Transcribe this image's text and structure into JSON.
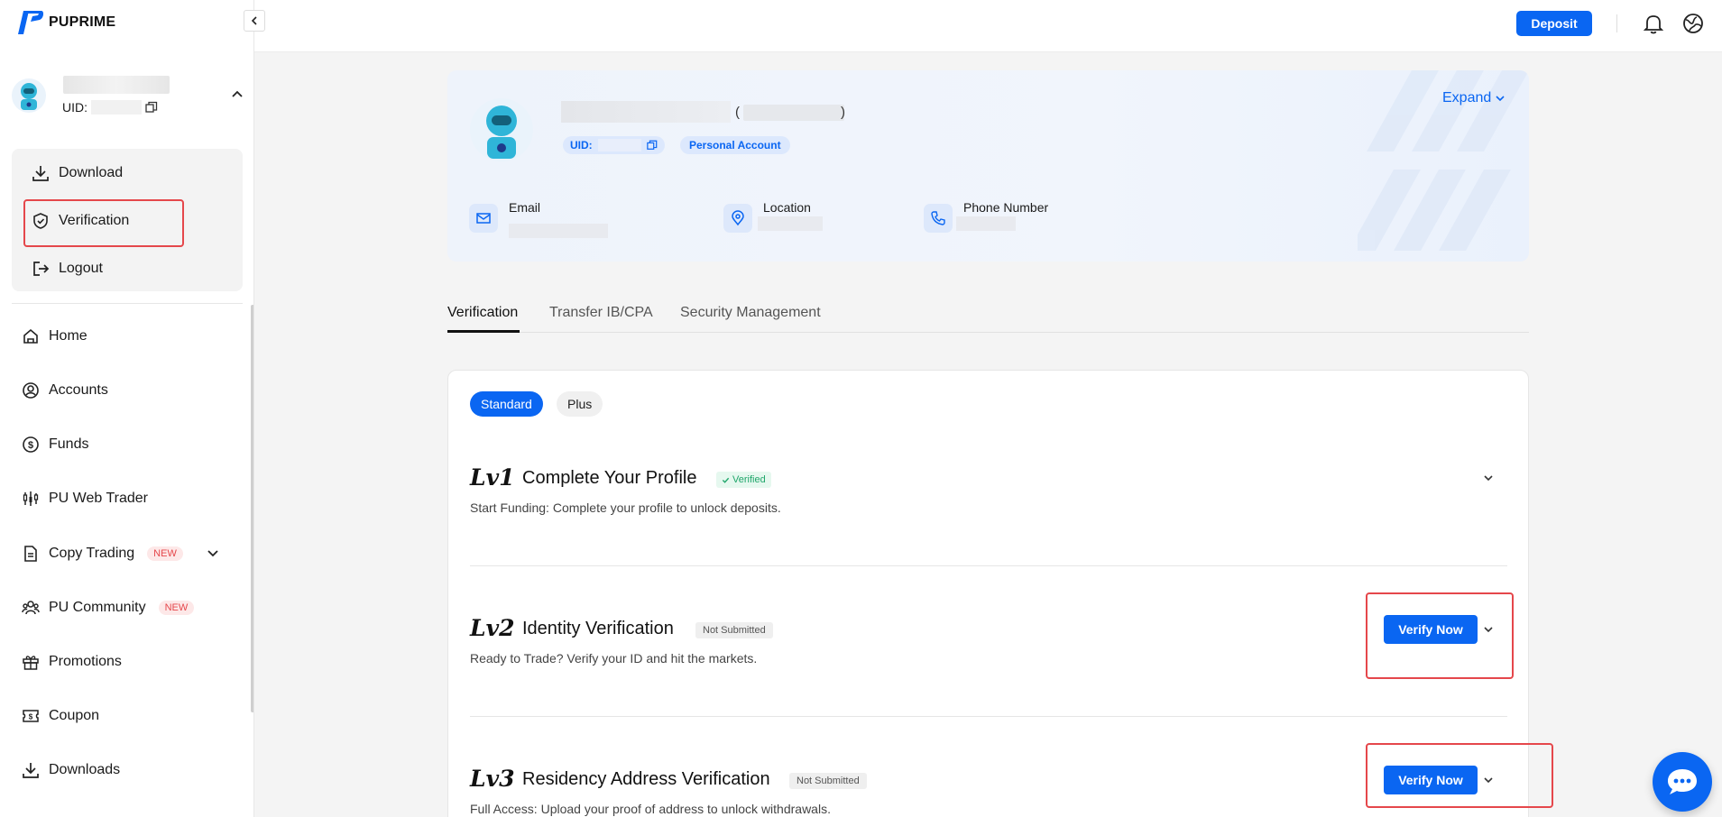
{
  "brand": {
    "name": "PUPRIME",
    "accent": "#0a66f2",
    "highlight": "#e5474b"
  },
  "user": {
    "uid_label": "UID:"
  },
  "account_menu": [
    {
      "label": "Download",
      "icon": "download-icon"
    },
    {
      "label": "Verification",
      "icon": "shield-check-icon"
    },
    {
      "label": "Logout",
      "icon": "logout-icon"
    }
  ],
  "nav": [
    {
      "label": "Home",
      "icon": "home-icon"
    },
    {
      "label": "Accounts",
      "icon": "user-circle-icon"
    },
    {
      "label": "Funds",
      "icon": "dollar-icon"
    },
    {
      "label": "PU Web Trader",
      "icon": "chart-icon"
    },
    {
      "label": "Copy Trading",
      "icon": "document-icon",
      "badge": "NEW"
    },
    {
      "label": "PU Community",
      "icon": "community-icon",
      "badge": "NEW"
    },
    {
      "label": "Promotions",
      "icon": "gift-icon"
    },
    {
      "label": "Coupon",
      "icon": "coupon-icon"
    },
    {
      "label": "Downloads",
      "icon": "download-icon"
    }
  ],
  "header": {
    "deposit_label": "Deposit"
  },
  "profile": {
    "uid_label": "UID:",
    "account_type": "Personal Account",
    "expand_label": "Expand",
    "paren_open": "(",
    "paren_close": ")",
    "fields": [
      {
        "label": "Email",
        "icon": "mail-icon"
      },
      {
        "label": "Location",
        "icon": "location-pin-icon"
      },
      {
        "label": "Phone Number",
        "icon": "phone-icon"
      }
    ]
  },
  "tabs": [
    "Verification",
    "Transfer IB/CPA",
    "Security Management"
  ],
  "segments": [
    "Standard",
    "Plus"
  ],
  "levels": [
    {
      "tag": "Lv1",
      "title": "Complete Your Profile",
      "status": "Verified",
      "desc": "Start Funding: Complete your profile to unlock deposits."
    },
    {
      "tag": "Lv2",
      "title": "Identity Verification",
      "status": "Not Submitted",
      "desc": "Ready to Trade? Verify your ID and hit the markets.",
      "action": "Verify Now"
    },
    {
      "tag": "Lv3",
      "title": "Residency Address Verification",
      "status": "Not Submitted",
      "desc": "Full Access: Upload your proof of address to unlock withdrawals.",
      "action": "Verify Now"
    }
  ]
}
